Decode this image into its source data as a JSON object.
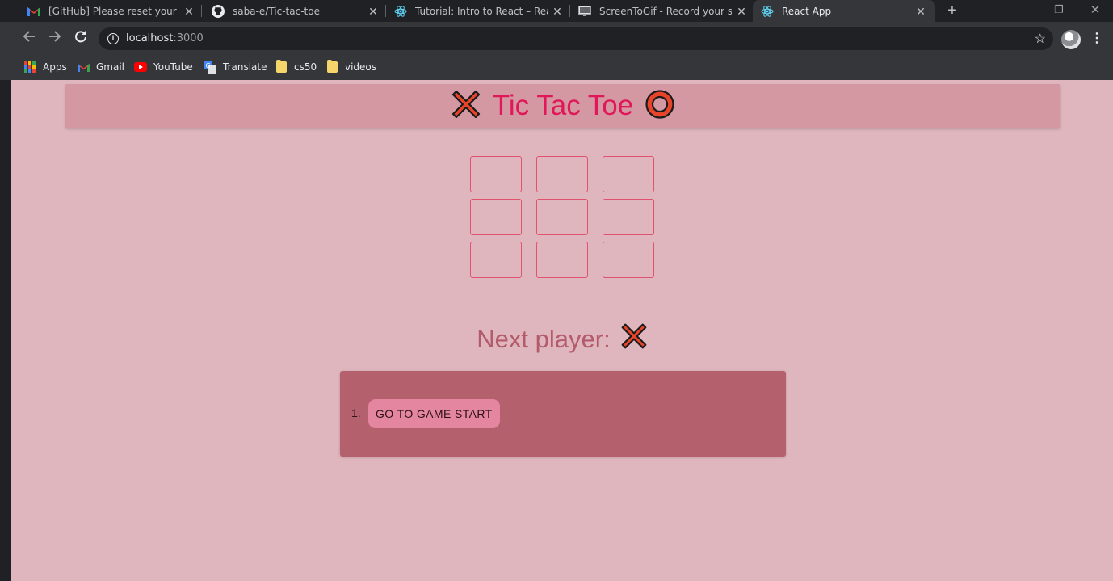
{
  "browser": {
    "tabs": [
      {
        "title": "[GitHub] Please reset your pass",
        "favicon": "gmail-icon",
        "active": false
      },
      {
        "title": "saba-e/Tic-tac-toe",
        "favicon": "github-icon",
        "active": false
      },
      {
        "title": "Tutorial: Intro to React – React",
        "favicon": "react-icon",
        "active": false
      },
      {
        "title": "ScreenToGif - Record your scre",
        "favicon": "screentogif-icon",
        "active": false
      },
      {
        "title": "React App",
        "favicon": "react-icon",
        "active": true
      }
    ],
    "address": {
      "host": "localhost",
      "port": ":3000"
    },
    "bookmarks": [
      {
        "label": "Apps",
        "icon": "apps-grid-icon"
      },
      {
        "label": "Gmail",
        "icon": "gmail-icon"
      },
      {
        "label": "YouTube",
        "icon": "youtube-icon"
      },
      {
        "label": "Translate",
        "icon": "translate-icon"
      },
      {
        "label": "cs50",
        "icon": "folder-icon"
      },
      {
        "label": "videos",
        "icon": "folder-icon"
      }
    ]
  },
  "app": {
    "title": "Tic Tac Toe",
    "board": [
      "",
      "",
      "",
      "",
      "",
      "",
      "",
      "",
      ""
    ],
    "status_label": "Next player:",
    "next_player": "X",
    "moves": [
      {
        "number": "1.",
        "label": "GO TO GAME START"
      }
    ],
    "colors": {
      "background": "#dfb6bd",
      "header": "#d398a2",
      "title": "#e0185a",
      "cell_border": "#e0526d",
      "status": "#b35a6b",
      "history_panel": "#b5606d",
      "move_button": "#e586a0",
      "x_mark": "#e8442a",
      "o_mark": "#e8442a"
    }
  }
}
